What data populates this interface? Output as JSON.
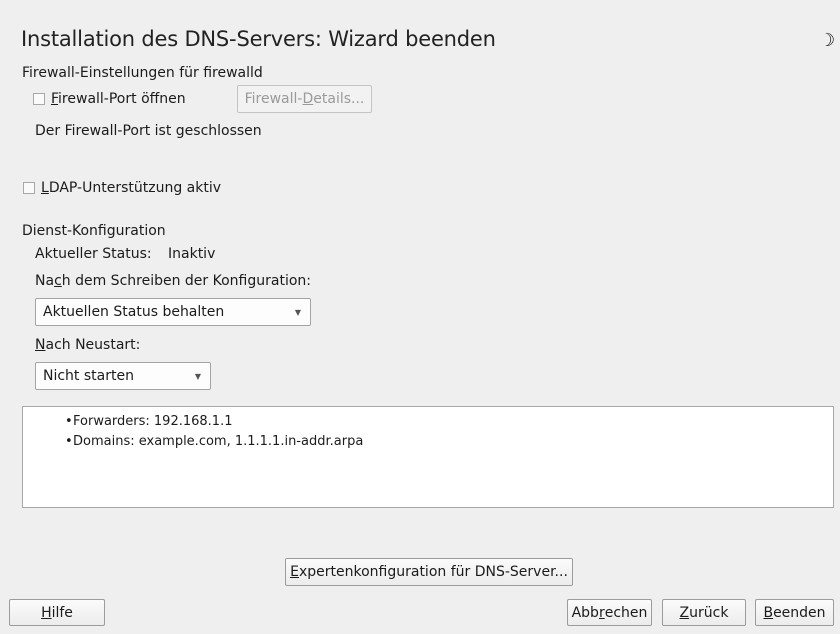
{
  "header": {
    "title": "Installation des DNS-Servers: Wizard beenden",
    "moon_icon": "☽"
  },
  "firewall": {
    "section_label": "Firewall-Einstellungen für firewalld",
    "open_port_label_key": "F",
    "open_port_label_rest": "irewall-Port öffnen",
    "details_button_pre": "Firewall-",
    "details_button_key": "D",
    "details_button_post": "etails...",
    "status_text": "Der Firewall-Port ist geschlossen"
  },
  "ldap": {
    "label_key": "L",
    "label_rest": "DAP-Unterstützung aktiv"
  },
  "service": {
    "section_label": "Dienst-Konfiguration",
    "current_status_label": "Aktueller Status:",
    "current_status_value": "Inaktiv",
    "after_write_pre": "Na",
    "after_write_key": "c",
    "after_write_post": "h dem Schreiben der Konfiguration:",
    "after_write_selected": "Aktuellen Status behalten",
    "after_reboot_key": "N",
    "after_reboot_rest": "ach Neustart:",
    "after_reboot_selected": "Nicht starten"
  },
  "summary": {
    "items": [
      "Forwarders: 192.168.1.1",
      "Domains: example.com, 1.1.1.1.in-addr.arpa"
    ]
  },
  "expert_button": {
    "key": "E",
    "rest": "xpertenkonfiguration für DNS-Server..."
  },
  "footer": {
    "help_key": "H",
    "help_rest": "ilfe",
    "cancel_pre": "Abb",
    "cancel_key": "r",
    "cancel_post": "echen",
    "back_key": "Z",
    "back_rest": "urück",
    "finish_key": "B",
    "finish_rest": "eenden"
  }
}
